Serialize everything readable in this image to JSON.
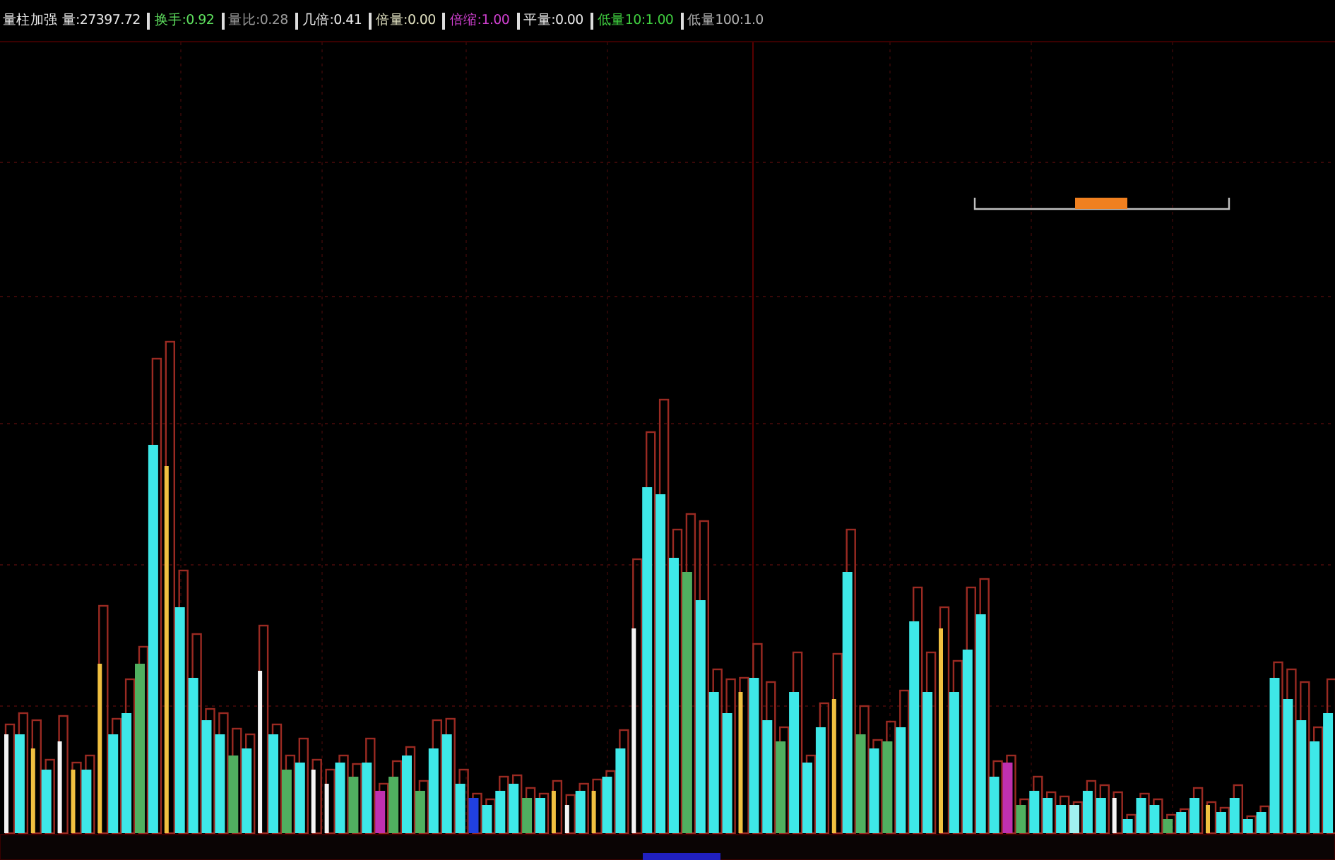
{
  "chart_title": "量柱加强",
  "indicators": [
    {
      "text": "量:27397.72",
      "color": "#e8e8e8"
    },
    {
      "text": "换手:0.92",
      "color": "#5ee05e"
    },
    {
      "text": "量比:0.28",
      "color": "#9a9a9a"
    },
    {
      "text": "几倍:0.41",
      "color": "#e8e8e8"
    },
    {
      "text": "倍量:0.00",
      "color": "#e0e0c0"
    },
    {
      "text": "倍缩:1.00",
      "color": "#d040d0"
    },
    {
      "text": "平量:0.00",
      "color": "#e8e8e8"
    },
    {
      "text": "低量10:1.00",
      "color": "#40d040"
    },
    {
      "text": "低量100:1.0",
      "color": "#b0b0b0"
    }
  ]
}
